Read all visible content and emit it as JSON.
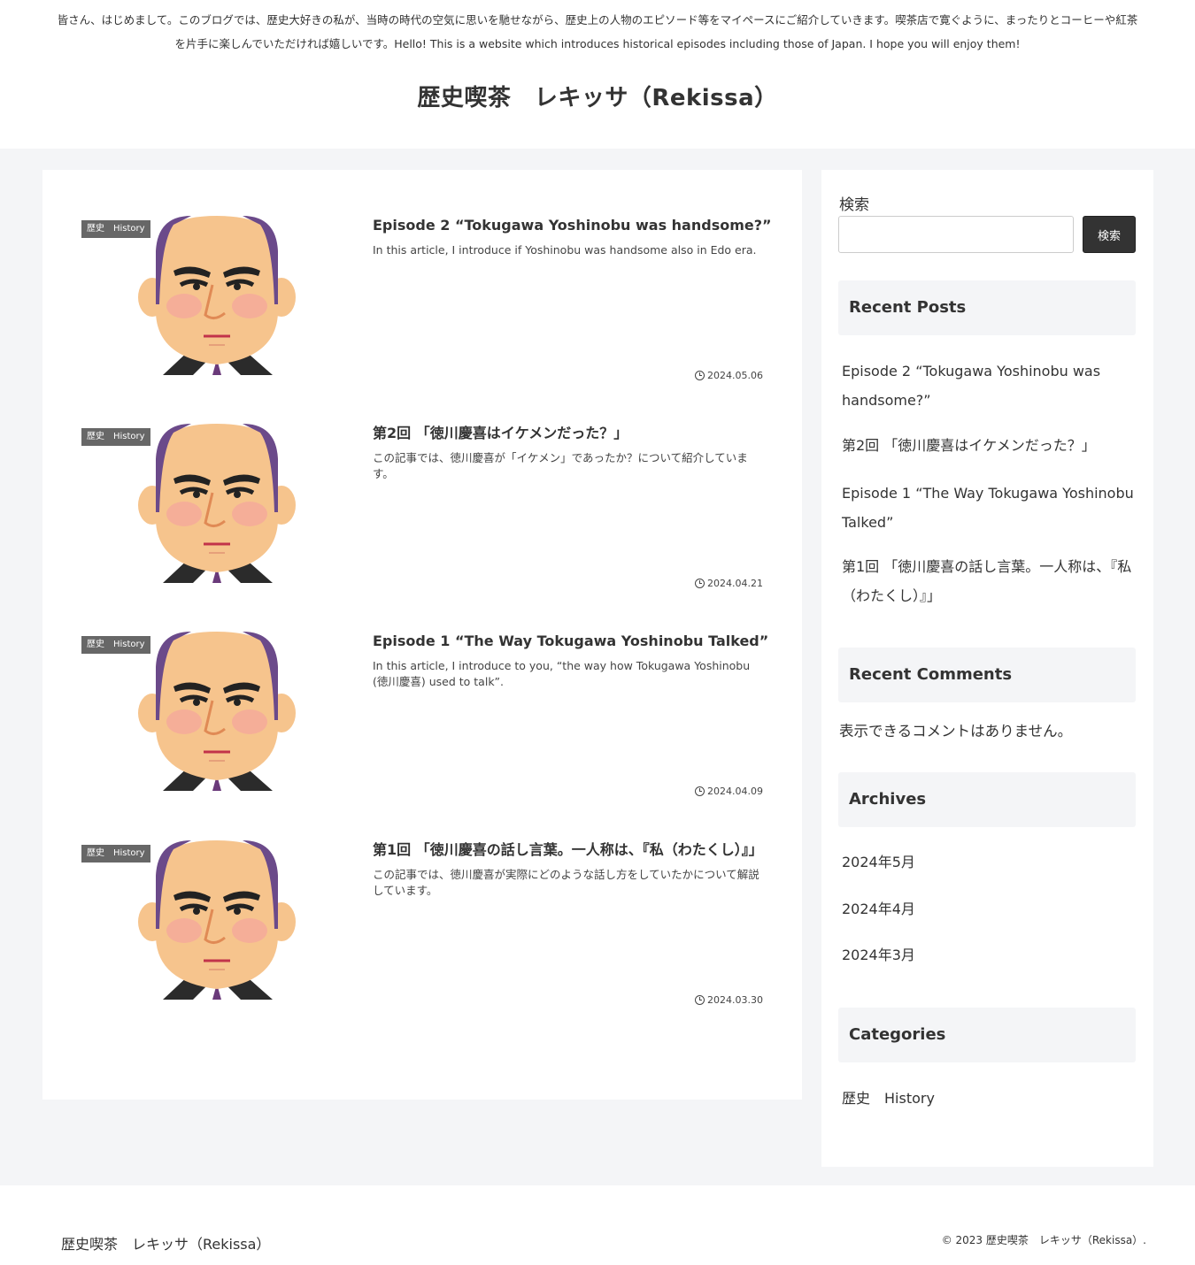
{
  "header": {
    "tagline": "皆さん、はじめまして。このブログでは、歴史大好きの私が、当時の時代の空気に思いを馳せながら、歴史上の人物のエピソード等をマイペースにご紹介していきます。喫茶店で寛ぐように、まったりとコーヒーや紅茶を片手に楽しんでいただければ嬉しいです。Hello! This is a website which introduces historical episodes including those of Japan. I hope you will enjoy them!",
    "site_title": "歴史喫茶　レキッサ（Rekissa）"
  },
  "posts": [
    {
      "category": "歴史　History",
      "title": "Episode 2 “Tokugawa Yoshinobu was handsome?”",
      "snippet": "In this article, I introduce if Yoshinobu was handsome also in Edo era.",
      "date": "2024.05.06"
    },
    {
      "category": "歴史　History",
      "title": "第2回 「徳川慶喜はイケメンだった？」",
      "snippet": "この記事では、徳川慶喜が「イケメン」であったか？について紹介しています。",
      "date": "2024.04.21"
    },
    {
      "category": "歴史　History",
      "title": "Episode 1 “The Way Tokugawa Yoshinobu Talked”",
      "snippet": "In this article, I introduce to you, “the way how Tokugawa Yoshinobu (徳川慶喜) used to talk”.",
      "date": "2024.04.09"
    },
    {
      "category": "歴史　History",
      "title": "第1回 「徳川慶喜の話し言葉。一人称は、『私（わたくし）』」",
      "snippet": "この記事では、徳川慶喜が実際にどのような話し方をしていたかについて解説しています。",
      "date": "2024.03.30"
    }
  ],
  "sidebar": {
    "search": {
      "label": "検索",
      "button": "検索",
      "value": ""
    },
    "recent_posts": {
      "heading": "Recent Posts",
      "items": [
        "Episode 2 “Tokugawa Yoshinobu was handsome?”",
        "第2回 「徳川慶喜はイケメンだった？」",
        "Episode 1 “The Way Tokugawa Yoshinobu Talked”",
        "第1回 「徳川慶喜の話し言葉。一人称は、『私（わたくし）』」"
      ]
    },
    "recent_comments": {
      "heading": "Recent Comments",
      "empty_text": "表示できるコメントはありません。"
    },
    "archives": {
      "heading": "Archives",
      "items": [
        "2024年5月",
        "2024年4月",
        "2024年3月"
      ]
    },
    "categories": {
      "heading": "Categories",
      "items": [
        "歴史　History"
      ]
    }
  },
  "footer": {
    "title": "歴史喫茶　レキッサ（Rekissa）",
    "copyright": "© 2023 歴史喫茶　レキッサ（Rekissa）."
  },
  "icons": {
    "date": "clock-icon",
    "thumbnail": "samurai-face-illustration"
  }
}
